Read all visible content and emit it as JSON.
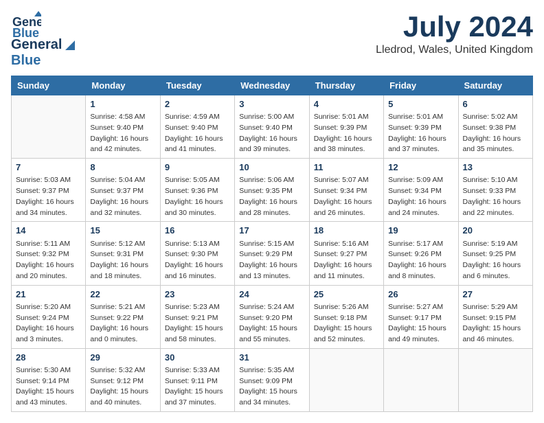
{
  "header": {
    "logo_line1": "General",
    "logo_line2": "Blue",
    "month": "July 2024",
    "location": "Lledrod, Wales, United Kingdom"
  },
  "weekdays": [
    "Sunday",
    "Monday",
    "Tuesday",
    "Wednesday",
    "Thursday",
    "Friday",
    "Saturday"
  ],
  "weeks": [
    [
      {
        "day": "",
        "info": ""
      },
      {
        "day": "1",
        "info": "Sunrise: 4:58 AM\nSunset: 9:40 PM\nDaylight: 16 hours\nand 42 minutes."
      },
      {
        "day": "2",
        "info": "Sunrise: 4:59 AM\nSunset: 9:40 PM\nDaylight: 16 hours\nand 41 minutes."
      },
      {
        "day": "3",
        "info": "Sunrise: 5:00 AM\nSunset: 9:40 PM\nDaylight: 16 hours\nand 39 minutes."
      },
      {
        "day": "4",
        "info": "Sunrise: 5:01 AM\nSunset: 9:39 PM\nDaylight: 16 hours\nand 38 minutes."
      },
      {
        "day": "5",
        "info": "Sunrise: 5:01 AM\nSunset: 9:39 PM\nDaylight: 16 hours\nand 37 minutes."
      },
      {
        "day": "6",
        "info": "Sunrise: 5:02 AM\nSunset: 9:38 PM\nDaylight: 16 hours\nand 35 minutes."
      }
    ],
    [
      {
        "day": "7",
        "info": "Sunrise: 5:03 AM\nSunset: 9:37 PM\nDaylight: 16 hours\nand 34 minutes."
      },
      {
        "day": "8",
        "info": "Sunrise: 5:04 AM\nSunset: 9:37 PM\nDaylight: 16 hours\nand 32 minutes."
      },
      {
        "day": "9",
        "info": "Sunrise: 5:05 AM\nSunset: 9:36 PM\nDaylight: 16 hours\nand 30 minutes."
      },
      {
        "day": "10",
        "info": "Sunrise: 5:06 AM\nSunset: 9:35 PM\nDaylight: 16 hours\nand 28 minutes."
      },
      {
        "day": "11",
        "info": "Sunrise: 5:07 AM\nSunset: 9:34 PM\nDaylight: 16 hours\nand 26 minutes."
      },
      {
        "day": "12",
        "info": "Sunrise: 5:09 AM\nSunset: 9:34 PM\nDaylight: 16 hours\nand 24 minutes."
      },
      {
        "day": "13",
        "info": "Sunrise: 5:10 AM\nSunset: 9:33 PM\nDaylight: 16 hours\nand 22 minutes."
      }
    ],
    [
      {
        "day": "14",
        "info": "Sunrise: 5:11 AM\nSunset: 9:32 PM\nDaylight: 16 hours\nand 20 minutes."
      },
      {
        "day": "15",
        "info": "Sunrise: 5:12 AM\nSunset: 9:31 PM\nDaylight: 16 hours\nand 18 minutes."
      },
      {
        "day": "16",
        "info": "Sunrise: 5:13 AM\nSunset: 9:30 PM\nDaylight: 16 hours\nand 16 minutes."
      },
      {
        "day": "17",
        "info": "Sunrise: 5:15 AM\nSunset: 9:29 PM\nDaylight: 16 hours\nand 13 minutes."
      },
      {
        "day": "18",
        "info": "Sunrise: 5:16 AM\nSunset: 9:27 PM\nDaylight: 16 hours\nand 11 minutes."
      },
      {
        "day": "19",
        "info": "Sunrise: 5:17 AM\nSunset: 9:26 PM\nDaylight: 16 hours\nand 8 minutes."
      },
      {
        "day": "20",
        "info": "Sunrise: 5:19 AM\nSunset: 9:25 PM\nDaylight: 16 hours\nand 6 minutes."
      }
    ],
    [
      {
        "day": "21",
        "info": "Sunrise: 5:20 AM\nSunset: 9:24 PM\nDaylight: 16 hours\nand 3 minutes."
      },
      {
        "day": "22",
        "info": "Sunrise: 5:21 AM\nSunset: 9:22 PM\nDaylight: 16 hours\nand 0 minutes."
      },
      {
        "day": "23",
        "info": "Sunrise: 5:23 AM\nSunset: 9:21 PM\nDaylight: 15 hours\nand 58 minutes."
      },
      {
        "day": "24",
        "info": "Sunrise: 5:24 AM\nSunset: 9:20 PM\nDaylight: 15 hours\nand 55 minutes."
      },
      {
        "day": "25",
        "info": "Sunrise: 5:26 AM\nSunset: 9:18 PM\nDaylight: 15 hours\nand 52 minutes."
      },
      {
        "day": "26",
        "info": "Sunrise: 5:27 AM\nSunset: 9:17 PM\nDaylight: 15 hours\nand 49 minutes."
      },
      {
        "day": "27",
        "info": "Sunrise: 5:29 AM\nSunset: 9:15 PM\nDaylight: 15 hours\nand 46 minutes."
      }
    ],
    [
      {
        "day": "28",
        "info": "Sunrise: 5:30 AM\nSunset: 9:14 PM\nDaylight: 15 hours\nand 43 minutes."
      },
      {
        "day": "29",
        "info": "Sunrise: 5:32 AM\nSunset: 9:12 PM\nDaylight: 15 hours\nand 40 minutes."
      },
      {
        "day": "30",
        "info": "Sunrise: 5:33 AM\nSunset: 9:11 PM\nDaylight: 15 hours\nand 37 minutes."
      },
      {
        "day": "31",
        "info": "Sunrise: 5:35 AM\nSunset: 9:09 PM\nDaylight: 15 hours\nand 34 minutes."
      },
      {
        "day": "",
        "info": ""
      },
      {
        "day": "",
        "info": ""
      },
      {
        "day": "",
        "info": ""
      }
    ]
  ]
}
